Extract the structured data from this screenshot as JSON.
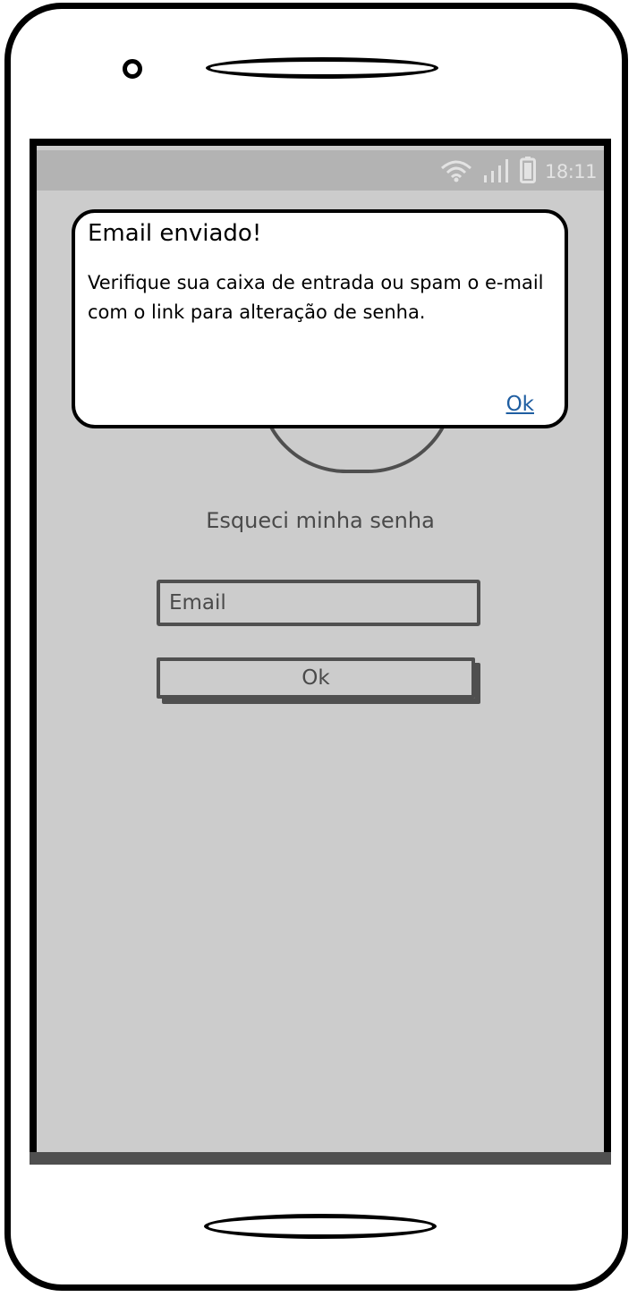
{
  "status_bar": {
    "time": "18:11",
    "icons": [
      "wifi-icon",
      "signal-icon",
      "battery-icon"
    ]
  },
  "screen": {
    "title": "Esqueci minha senha",
    "email_placeholder": "Email",
    "ok_label": "Ok"
  },
  "dialog": {
    "title": "Email enviado!",
    "message": "Verifique sua caixa de entrada ou spam o e-mail com o link para alteração de senha.",
    "ok_label": "Ok"
  },
  "colors": {
    "screen_background": "#cccccc",
    "status_bar": "#b3b3b3",
    "link": "#1f5ea1",
    "outline": "#4f4f4f"
  }
}
